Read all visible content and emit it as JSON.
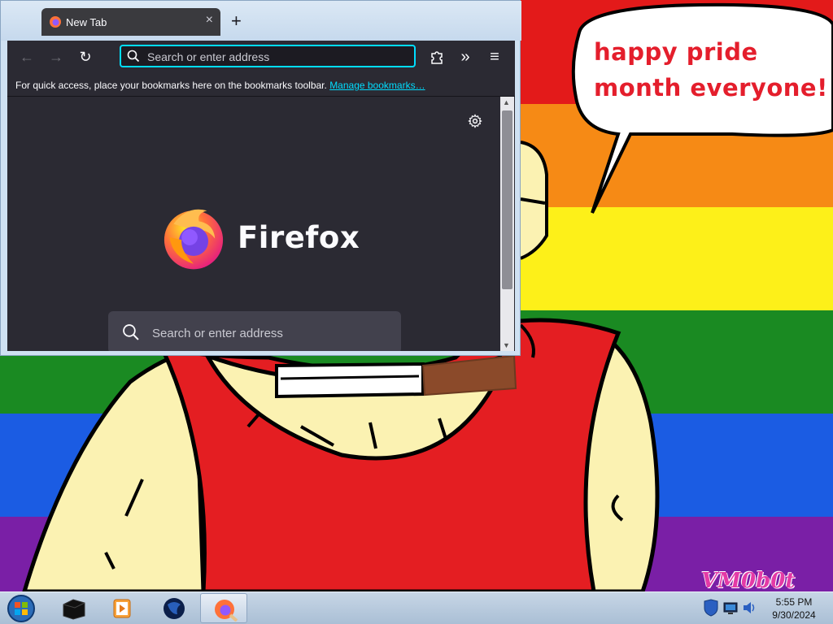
{
  "desktop": {
    "speech_bubble_text": "happy pride month everyone!",
    "watermark": "VM0b0t",
    "rainbow_colors": [
      "#e31a1a",
      "#f68a15",
      "#fdf019",
      "#1a8a22",
      "#1b5ce3",
      "#7a1fa6"
    ]
  },
  "browser": {
    "tab": {
      "title": "New Tab",
      "close_icon": "×",
      "favicon": "firefox-icon"
    },
    "new_tab_icon": "+",
    "toolbar": {
      "back_icon": "←",
      "forward_icon": "→",
      "reload_icon": "↻",
      "url_placeholder": "Search or enter address",
      "extensions_icon": "puzzle-icon",
      "overflow_icon": "»",
      "menu_icon": "≡"
    },
    "bookmarks_bar": {
      "text": "For quick access, place your bookmarks here on the bookmarks toolbar. ",
      "link": "Manage bookmarks…"
    },
    "newtab_page": {
      "brand": "Firefox",
      "search_placeholder": "Search or enter address",
      "settings_icon": "gear-icon"
    },
    "accent_color": "#00ddff",
    "background_color": "#2b2a33"
  },
  "taskbar": {
    "apps": [
      "start-orb",
      "terminal",
      "media-player",
      "globe-browser",
      "firefox"
    ],
    "active_app": "firefox",
    "clock": {
      "time": "5:55 PM",
      "date": "9/30/2024"
    }
  }
}
